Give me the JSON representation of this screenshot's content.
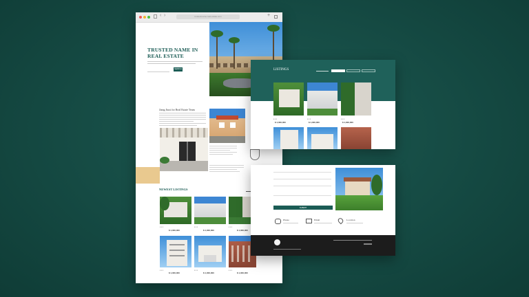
{
  "browser": {
    "url": "trusted-name-real-estate.com",
    "hero": {
      "title_line1": "TRUSTED NAME IN",
      "title_line2": "REAL ESTATE",
      "search_button": "SEARCH"
    },
    "about": {
      "title": "Jiang Jiuxi for Real Estate Team"
    },
    "newest": {
      "title": "NEWEST LISTINGS"
    },
    "listings": [
      {
        "price": "$ 1,000,000"
      },
      {
        "price": "$ 1,000,000"
      },
      {
        "price": "$ 1,000,000"
      },
      {
        "price": "$ 1,000,000"
      },
      {
        "price": "$ 1,000,000"
      },
      {
        "price": "$ 1,000,000"
      }
    ]
  },
  "listings_panel": {
    "title": "LISTINGS",
    "prices": [
      "$ 1,000,000",
      "$ 1,000,000",
      "$ 1,000,000"
    ]
  },
  "contact_panel": {
    "submit": "SUBMIT",
    "phone_label": "Phone",
    "email_label": "Email",
    "location_label": "Location"
  },
  "colors": {
    "teal": "#1b5c55",
    "sand": "#e9c98f",
    "background": "#154a43"
  }
}
